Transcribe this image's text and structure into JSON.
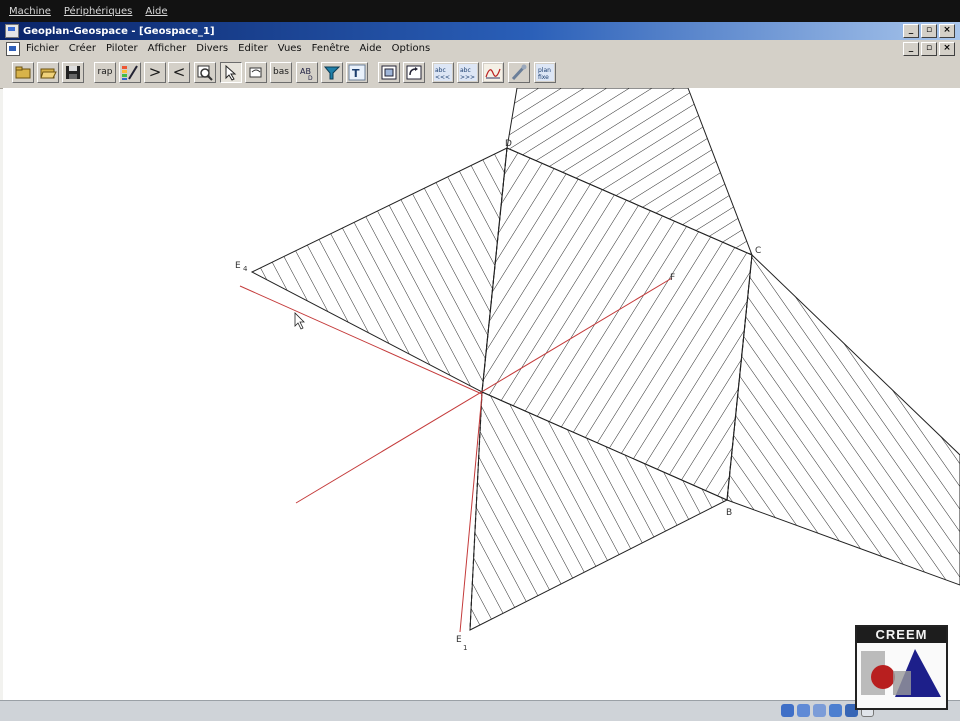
{
  "vm_menu": {
    "items": [
      "Machine",
      "Périphériques",
      "Aide"
    ]
  },
  "window": {
    "title": "Geoplan-Geospace - [Geospace_1]"
  },
  "app_menu": {
    "items": [
      "Fichier",
      "Créer",
      "Piloter",
      "Afficher",
      "Divers",
      "Editer",
      "Vues",
      "Fenêtre",
      "Aide",
      "Options"
    ]
  },
  "toolbar": {
    "buttons": [
      {
        "name": "open-icon",
        "label": ""
      },
      {
        "name": "open-folder-icon",
        "label": ""
      },
      {
        "name": "save-icon",
        "label": ""
      },
      {
        "name": "rap-button",
        "label": "rap"
      },
      {
        "name": "color-pen-icon",
        "label": ""
      },
      {
        "name": "greater-icon",
        "label": ">"
      },
      {
        "name": "less-icon",
        "label": "<"
      },
      {
        "name": "zoom-icon",
        "label": ""
      },
      {
        "name": "pointer-tool-icon",
        "label": ""
      },
      {
        "name": "rotate-tool-icon",
        "label": ""
      },
      {
        "name": "bas-button",
        "label": "bas"
      },
      {
        "name": "label-tool-icon",
        "label": ""
      },
      {
        "name": "cursor-tool-icon",
        "label": ""
      },
      {
        "name": "text-tool-icon",
        "label": "T"
      },
      {
        "name": "view-3d-icon",
        "label": ""
      },
      {
        "name": "refresh-icon",
        "label": ""
      },
      {
        "name": "angle-1-icon",
        "label": ""
      },
      {
        "name": "angle-2-icon",
        "label": ""
      },
      {
        "name": "curve-icon",
        "label": ""
      },
      {
        "name": "tool-icon",
        "label": ""
      },
      {
        "name": "plan-button",
        "label": ""
      }
    ]
  },
  "figure": {
    "points": {
      "D": "D",
      "C": "C",
      "E4": "E",
      "E4_sub": "4",
      "E1": "E",
      "E1_sub": "1",
      "B": "B",
      "F": "F"
    },
    "colors": {
      "edge": "#222222",
      "hatch": "#2a2a2a",
      "red_line": "#c43a3a"
    }
  },
  "logo": {
    "text": "CREEM"
  }
}
